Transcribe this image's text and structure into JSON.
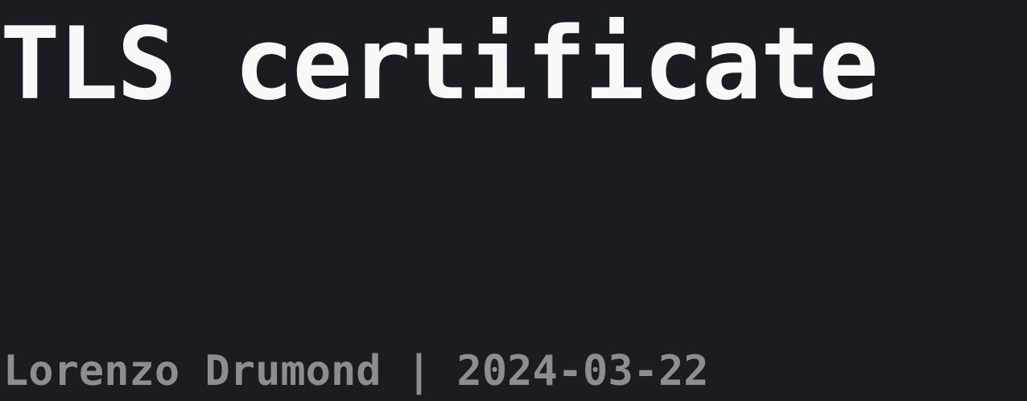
{
  "slide": {
    "title": "TLS certificate",
    "byline": "Lorenzo Drumond | 2024-03-22"
  },
  "colors": {
    "background": "#1b1c21",
    "title": "#f8f8f8",
    "byline": "#8c8d92"
  }
}
